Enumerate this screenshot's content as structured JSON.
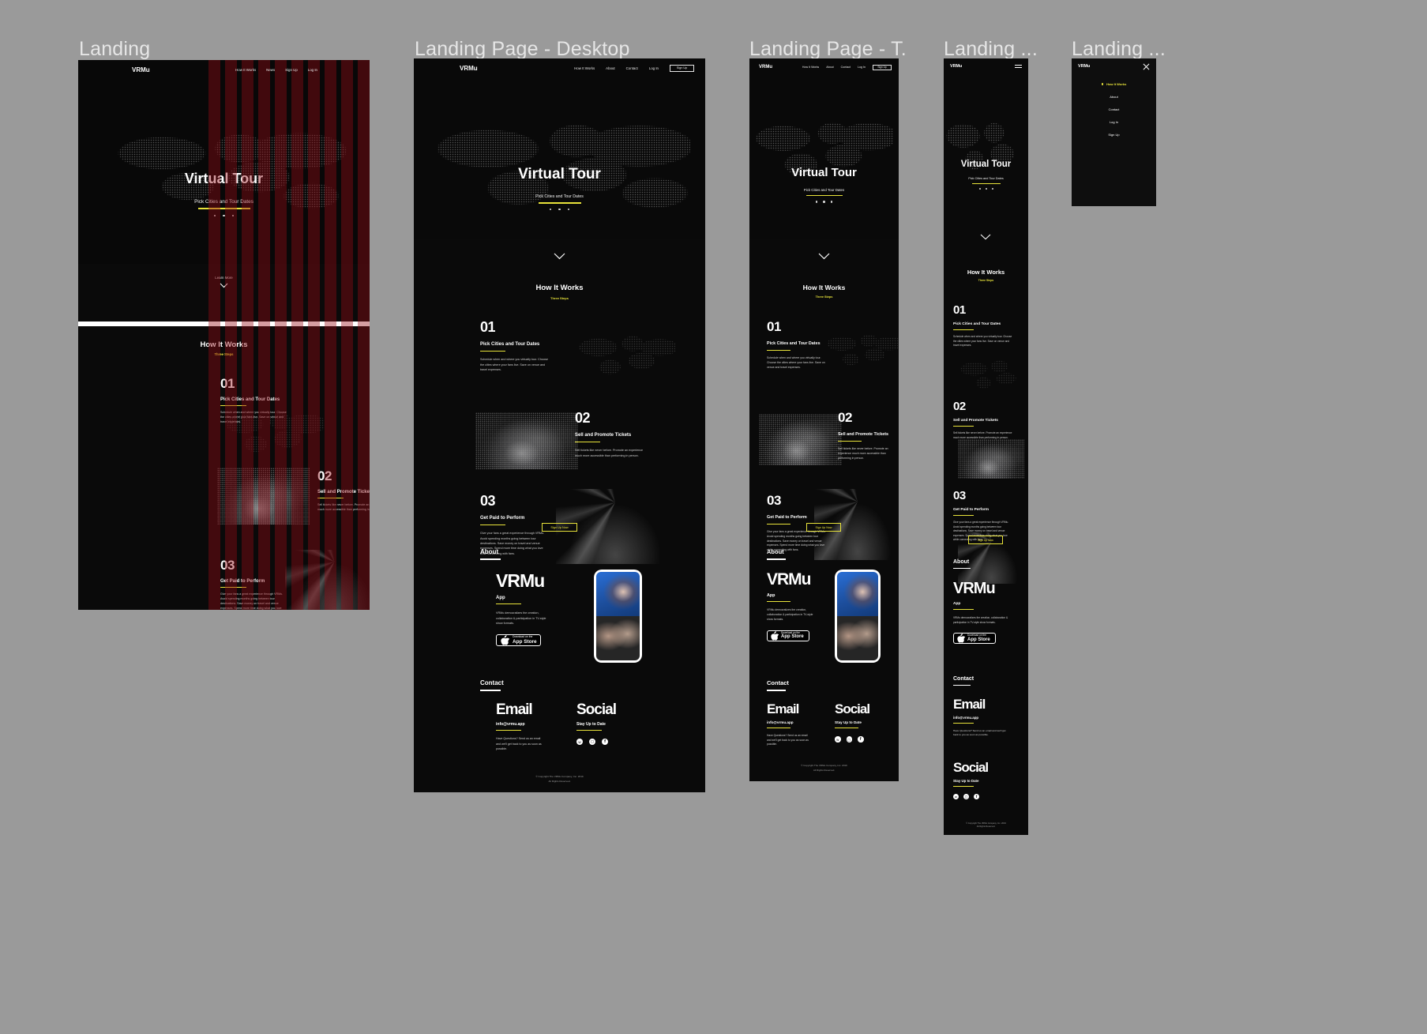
{
  "canvas": {
    "background": "#9a9a9a"
  },
  "accent": "#e8e33a",
  "frames": [
    {
      "label": "Landing"
    },
    {
      "label": "Landing Page - Desktop"
    },
    {
      "label": "Landing Page - T..."
    },
    {
      "label": "Landing ..."
    },
    {
      "label": "Landing ..."
    }
  ],
  "site": {
    "brand": "VRMu",
    "nav_landing": [
      "How It Works",
      "News",
      "Sign Up",
      "Log In"
    ],
    "nav_desktop": [
      "How It Works",
      "About",
      "Contact",
      "Log In"
    ],
    "nav_signup_button": "Sign Up",
    "hero": {
      "title": "Virtual Tour",
      "subtitle": "Pick Cities and Tour Dates",
      "dots": 3,
      "learn_more": "Learn More",
      "chevron": "chevron-down-icon"
    },
    "how": {
      "title": "How It Works",
      "kicker": "Three Steps",
      "steps": [
        {
          "number": "01",
          "heading": "Pick Cities and Tour Dates",
          "body": "Schedule when and where you virtually tour. Choose the cities where your fans live. Save on venue and travel expenses.",
          "art": "world-map"
        },
        {
          "number": "02",
          "heading": "Sell and Promote Tickets",
          "body": "Sell tickets like never before.  Promote an experience much more accessible than performing in person.",
          "art": "crowd"
        },
        {
          "number": "03",
          "heading": "Get Paid to Perform",
          "body": "Give your fans a great experience through VRMu. Avoid spending months going between tour destinations. Save money on travel and venue expenses. Spend more time doing what you love while connecting with fans.",
          "art": "stage"
        }
      ],
      "cta": "Sign Up Now"
    },
    "about": {
      "title": "About",
      "big_word": "VRMu",
      "sub": "App",
      "body": "VRMu democratizes the creation, collaboration & participation in TV-style show formats.",
      "appstore_small": "Download on the",
      "appstore_large": "App Store",
      "appstore_icon": "apple-icon"
    },
    "contact": {
      "title": "Contact",
      "email_word": "Email",
      "email_sub": "info@vrmu.app",
      "email_body": "Have Questions? Send us an email and we'll get back to you as soon as possible.",
      "social_word": "Social",
      "social_sub": "Stay Up to Date",
      "social_icons": [
        "twitter-icon",
        "instagram-icon",
        "facebook-icon"
      ]
    },
    "footer": {
      "line1": "© Copyright The VRMu Company, Inc. 2019",
      "line2": "All Rights Reserved."
    },
    "mobile_menu": {
      "items": [
        "How It Works",
        "About",
        "Contact",
        "Log In",
        "Sign Up"
      ],
      "active": "How It Works",
      "close_icon": "close-icon",
      "burger_icon": "hamburger-icon"
    }
  }
}
